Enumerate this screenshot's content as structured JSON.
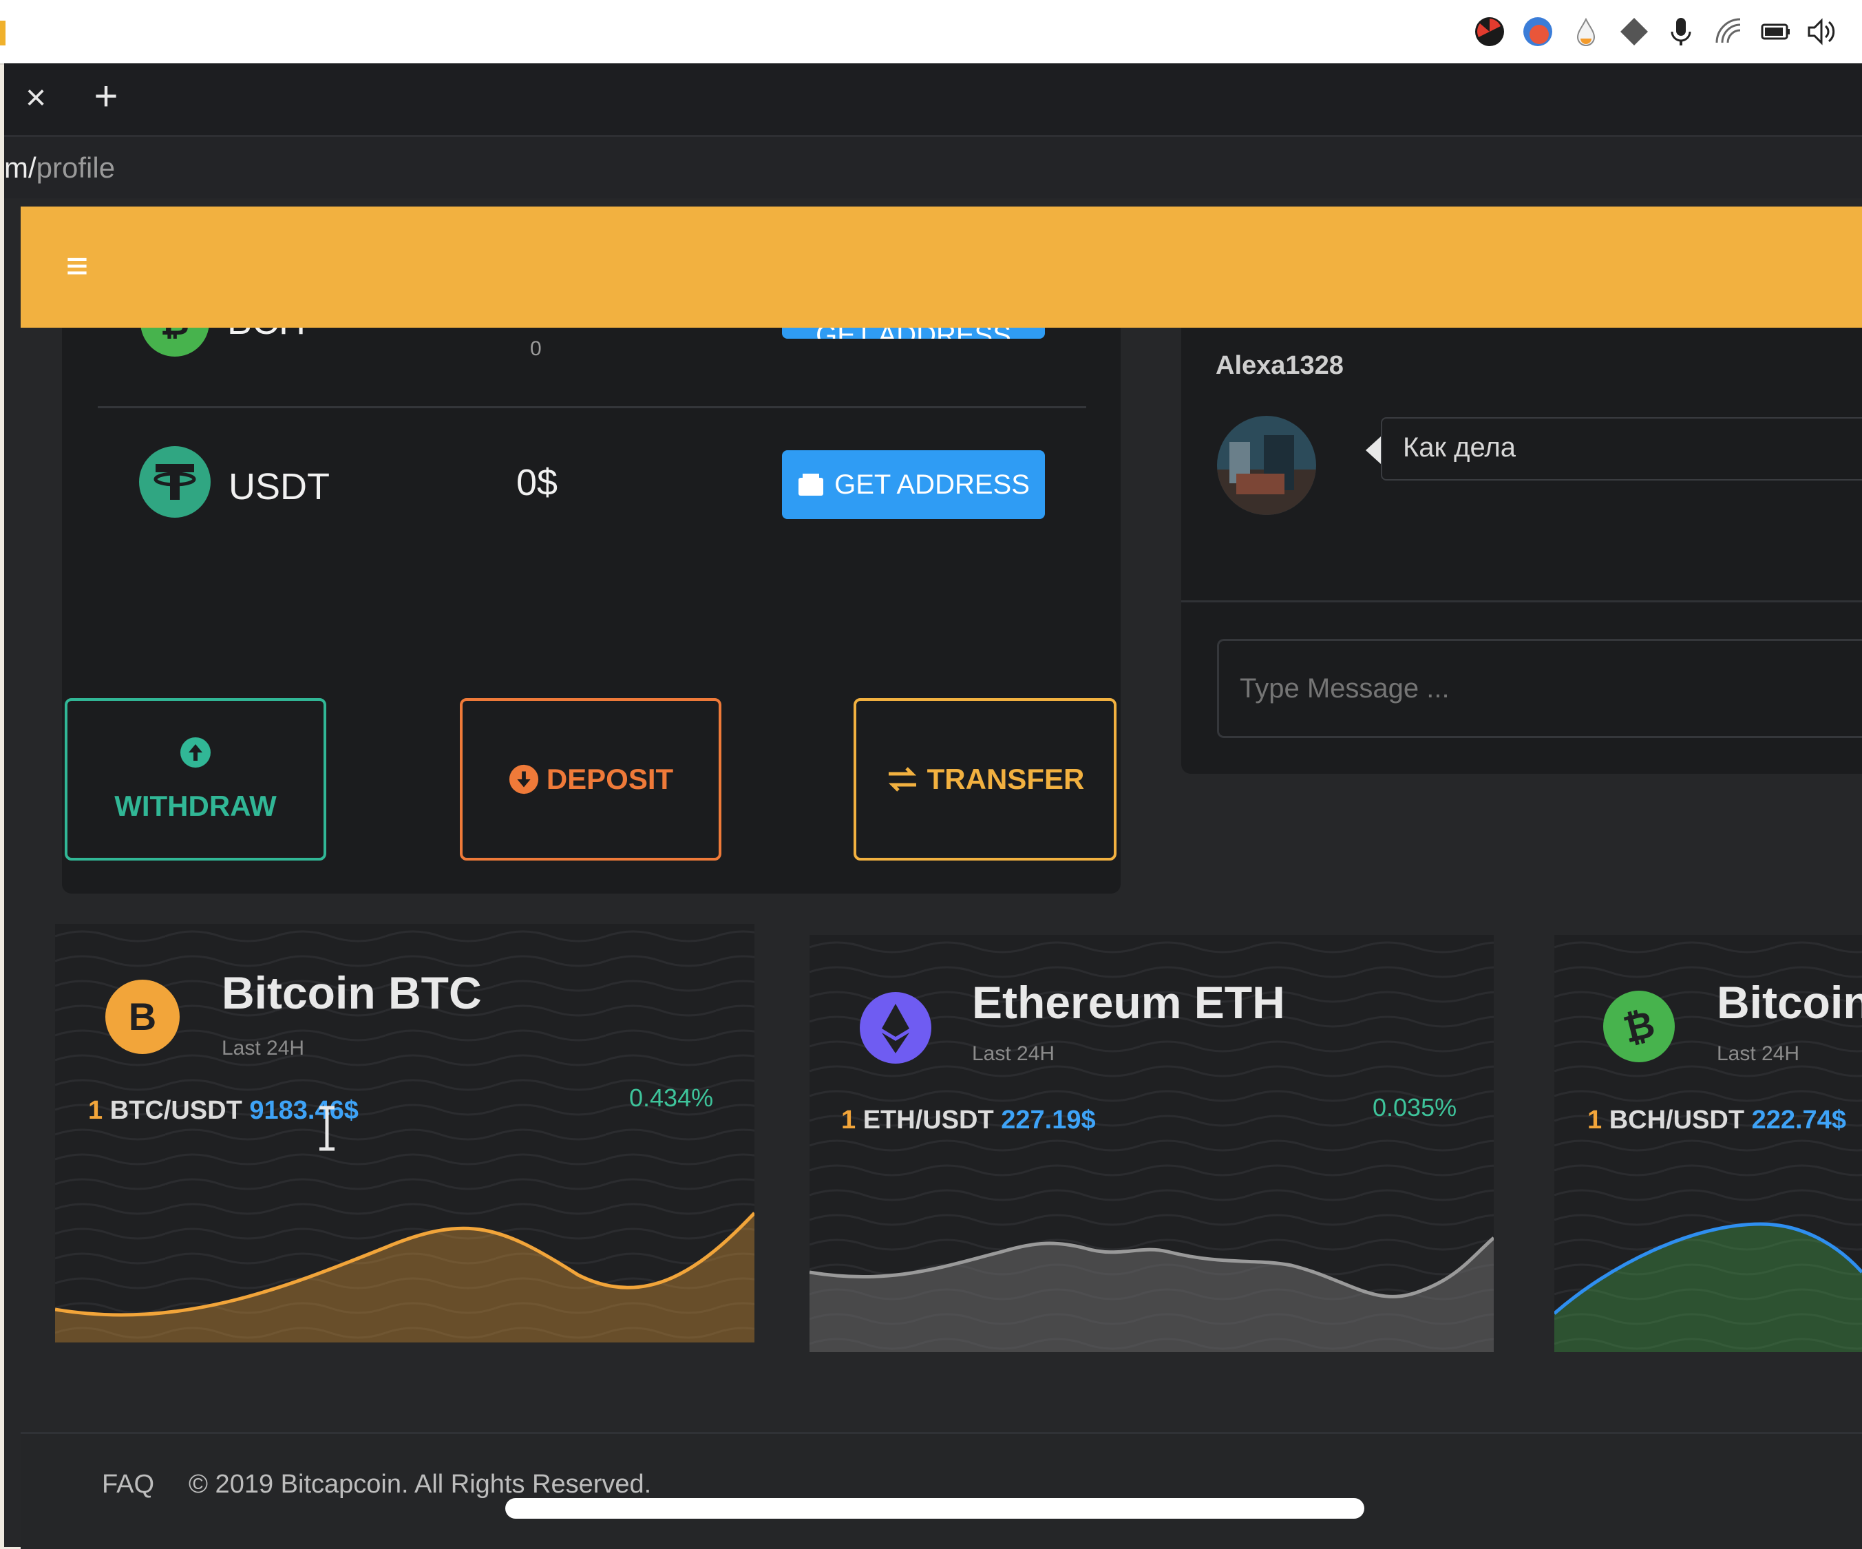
{
  "browser": {
    "tab_close": "×",
    "tab_new": "+",
    "url_prefix": "m/",
    "url_path": "profile"
  },
  "header": {
    "menu_glyph": "≡",
    "accent": "#f2b140"
  },
  "wallet": {
    "rows": [
      {
        "symbol": "BCH",
        "amount": "0",
        "button": "GET ADDRESS"
      },
      {
        "symbol": "USDT",
        "amount": "0$",
        "button": "GET ADDRESS"
      }
    ],
    "actions": {
      "withdraw": "WITHDRAW",
      "deposit": "DEPOSIT",
      "transfer": "TRANSFER"
    }
  },
  "chat": {
    "username": "Alexa1328",
    "message": "Как дела",
    "input_placeholder": "Type Message ..."
  },
  "markets": [
    {
      "title": "Bitcoin BTC",
      "subtitle": "Last 24H",
      "qty": "1",
      "pair": "BTC/USDT",
      "price": "9183.46$",
      "change": "0.434%",
      "accent": "#f2a53a",
      "icon": "bitcoin-icon"
    },
    {
      "title": "Ethereum ETH",
      "subtitle": "Last 24H",
      "qty": "1",
      "pair": "ETH/USDT",
      "price": "227.19$",
      "change": "0.035%",
      "accent": "#6f5cf2",
      "icon": "ethereum-icon"
    },
    {
      "title": "Bitcoin",
      "subtitle": "Last 24H",
      "qty": "1",
      "pair": "BCH/USDT",
      "price": "222.74$",
      "change": "",
      "accent": "#47b34d",
      "icon": "bitcoin-cash-icon"
    }
  ],
  "footer": {
    "faq": "FAQ",
    "copyright": "© 2019 Bitcapcoin. All Rights Reserved."
  },
  "colors": {
    "withdraw": "#31b796",
    "deposit": "#ef7a39",
    "transfer": "#f2b140",
    "get_address": "#2f9cf4"
  }
}
